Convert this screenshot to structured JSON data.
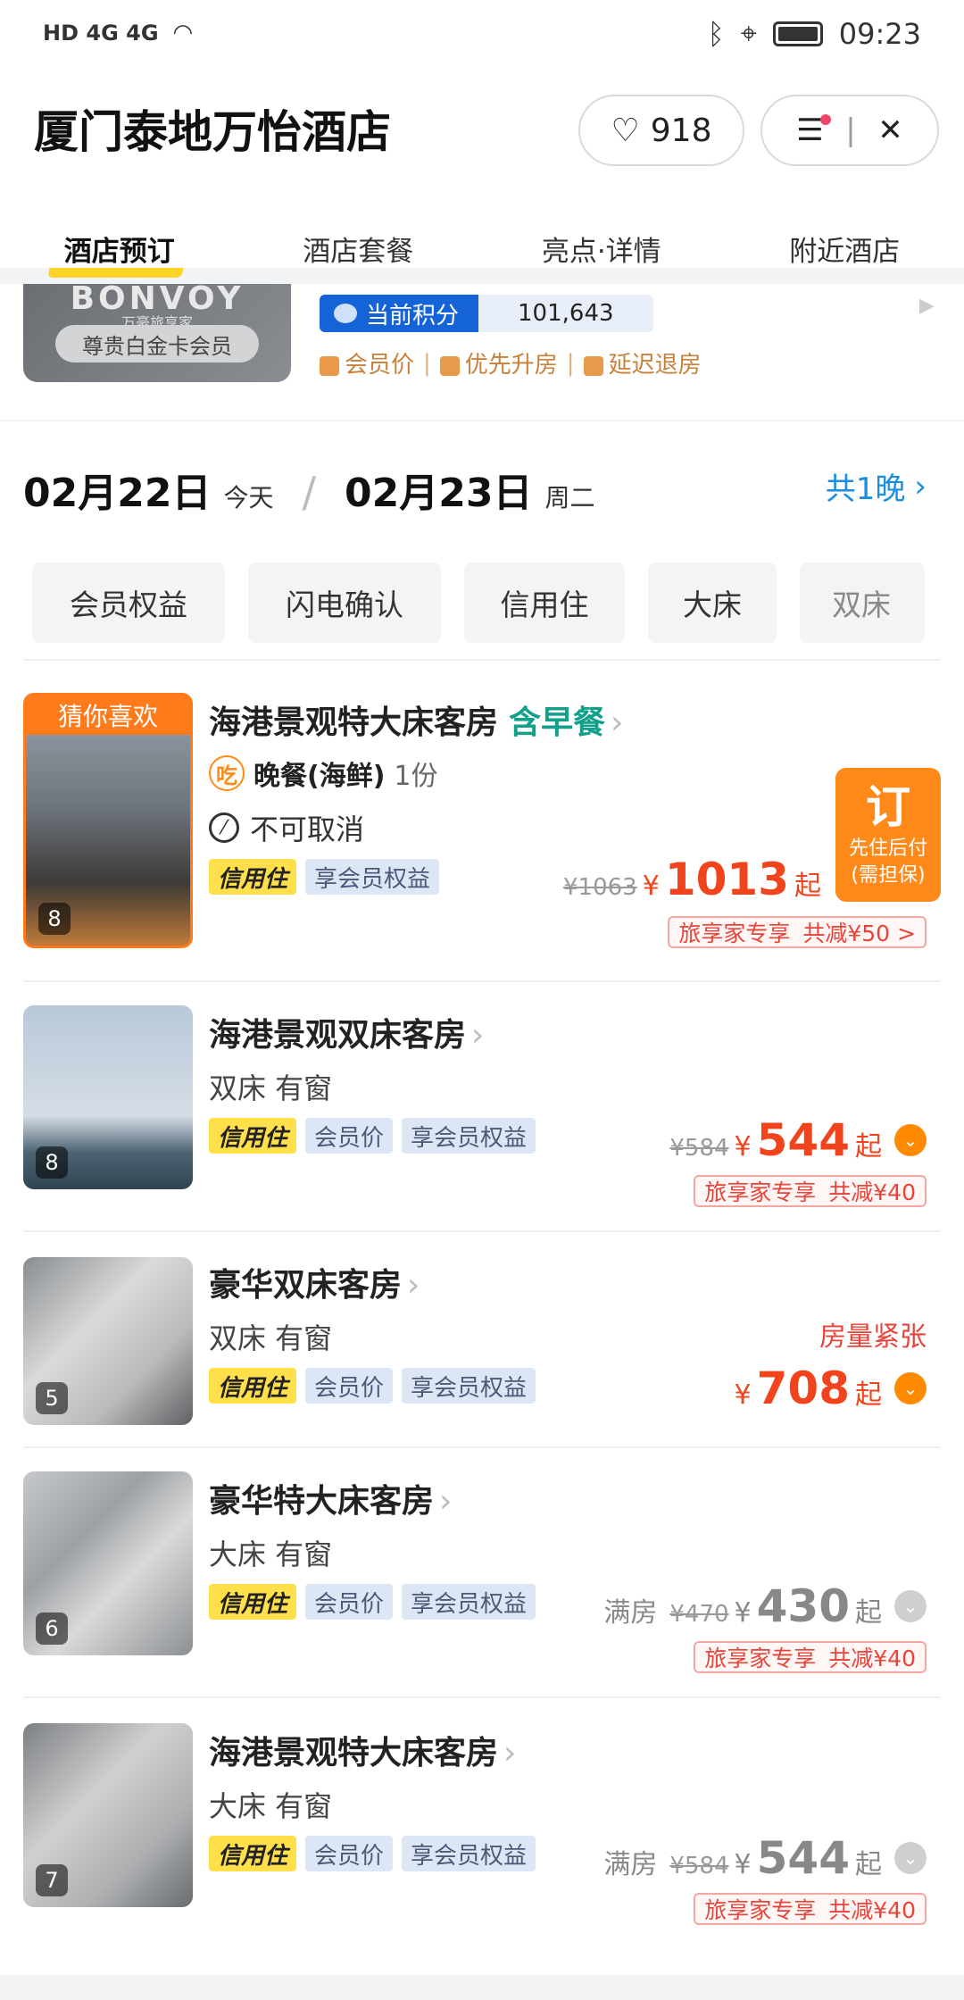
{
  "status": {
    "time": "09:23",
    "left": "HD 4G 4G"
  },
  "header": {
    "title": "厦门泰地万怡酒店",
    "fav_count": "918"
  },
  "tabs": [
    "酒店预订",
    "酒店套餐",
    "亮点·详情",
    "附近酒店"
  ],
  "member": {
    "brand": "BONVOY",
    "brand_sub": "万豪旅享家",
    "tier": "尊贵白金卡会员",
    "points_label": "当前积分",
    "points_value": "101,643",
    "perks": [
      "会员价",
      "优先升房",
      "延迟退房"
    ]
  },
  "dates": {
    "checkin": "02月22日",
    "checkin_day": "今天",
    "checkout": "02月23日",
    "checkout_day": "周二",
    "nights": "共1晚"
  },
  "filters": [
    "会员权益",
    "闪电确认",
    "信用住",
    "大床",
    "双床"
  ],
  "rooms": [
    {
      "badge": "猜你喜欢",
      "photos": "8",
      "name": "海港景观特大床客房",
      "breakfast": "含早餐",
      "meal_icon": "吃",
      "meal": "晚餐(海鲜)",
      "meal_qty": "1份",
      "cancel": "不可取消",
      "tags": [
        "信用住",
        "享会员权益"
      ],
      "old_price": "¥1063",
      "currency": "¥",
      "price": "1013",
      "qi": "起",
      "promo_a": "旅享家专享",
      "promo_b": "共减¥50 >",
      "book": "订",
      "book_note1": "先住后付",
      "book_note2": "(需担保)"
    },
    {
      "photos": "8",
      "name": "海港景观双床客房",
      "desc": "双床 有窗",
      "tags": [
        "信用住",
        "会员价",
        "享会员权益"
      ],
      "old_price": "¥584",
      "currency": "¥",
      "price": "544",
      "qi": "起",
      "promo_a": "旅享家专享",
      "promo_b": "共减¥40"
    },
    {
      "photos": "5",
      "name": "豪华双床客房",
      "desc": "双床 有窗",
      "tags": [
        "信用住",
        "会员价",
        "享会员权益"
      ],
      "note": "房量紧张",
      "currency": "¥",
      "price": "708",
      "qi": "起"
    },
    {
      "photos": "6",
      "name": "豪华特大床客房",
      "desc": "大床 有窗",
      "tags": [
        "信用住",
        "会员价",
        "享会员权益"
      ],
      "status": "满房",
      "old_price": "¥470",
      "currency": "¥",
      "price": "430",
      "qi": "起",
      "promo_a": "旅享家专享",
      "promo_b": "共减¥40"
    },
    {
      "photos": "7",
      "name": "海港景观特大床客房",
      "desc": "大床 有窗",
      "tags": [
        "信用住",
        "会员价",
        "享会员权益"
      ],
      "status": "满房",
      "old_price": "¥584",
      "currency": "¥",
      "price": "544",
      "qi": "起",
      "promo_a": "旅享家专享",
      "promo_b": "共减¥40"
    }
  ]
}
